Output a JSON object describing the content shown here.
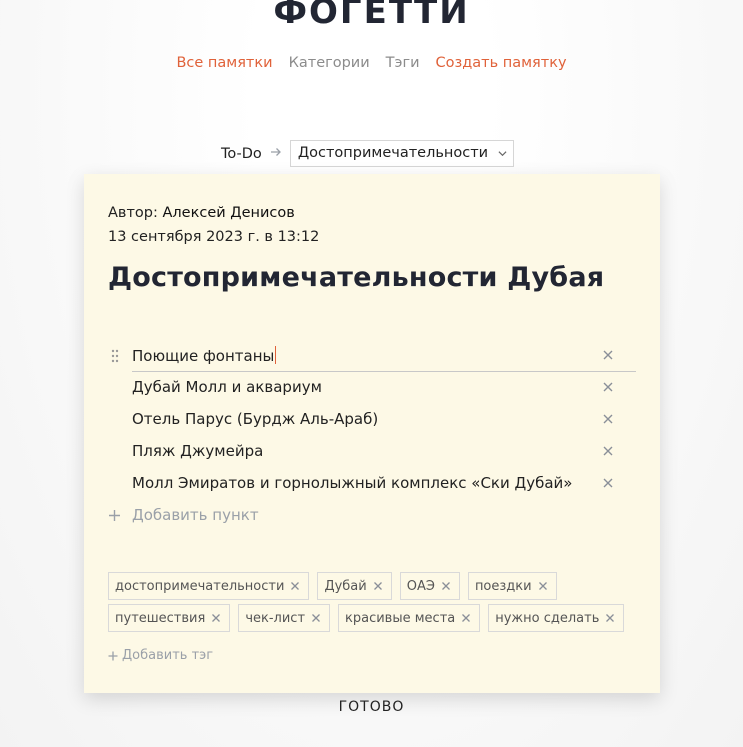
{
  "app": {
    "logo": "ФОГЕТТИ"
  },
  "nav": {
    "items": [
      {
        "label": "Все памятки",
        "color": "#e0623a"
      },
      {
        "label": "Категории",
        "color": "#8c8c8c"
      },
      {
        "label": "Тэги",
        "color": "#8c8c8c"
      },
      {
        "label": "Создать памятку",
        "color": "#e0623a"
      }
    ]
  },
  "breadcrumb": {
    "root": "To-Do",
    "arrow_icon": "arrow-right-icon",
    "category_select": "Достопримечательности",
    "select_icon": "chevron-down-icon"
  },
  "note": {
    "author_label": "Автор:",
    "author_name": "Алексей Денисов",
    "date": "13 сентября 2023 г. в 13:12",
    "title": "Достопримечательности Дубая",
    "background_color": "#fdf9e6",
    "items": [
      {
        "text": "Поющие фонтаны",
        "active": true
      },
      {
        "text": "Дубай Молл и аквариум"
      },
      {
        "text": "Отель Парус (Бурдж Аль-Араб)"
      },
      {
        "text": "Пляж Джумейра"
      },
      {
        "text": "Молл Эмиратов и горнолыжный комплекс «Ски Дубай»"
      }
    ],
    "add_item_label": "Добавить пункт",
    "tags": [
      [
        "достопримечательности",
        "Дубай",
        "ОАЭ",
        "поездки"
      ],
      [
        "путешествия",
        "чек-лист",
        "красивые места",
        "нужно сделать"
      ]
    ],
    "add_tag_label": "Добавить тэг"
  },
  "footer": {
    "done_label": "ГОТОВО"
  }
}
